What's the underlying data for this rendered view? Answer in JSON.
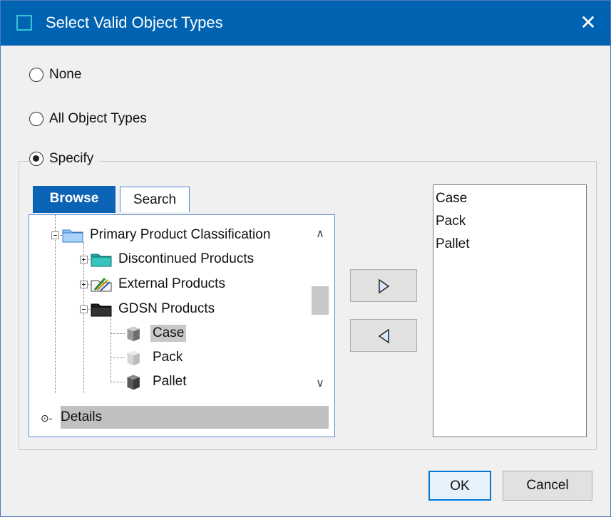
{
  "window": {
    "title": "Select Valid Object Types",
    "close_glyph": "✕"
  },
  "radios": [
    {
      "label": "None",
      "checked": false
    },
    {
      "label": "All Object Types",
      "checked": false
    },
    {
      "label": "Specify",
      "checked": true
    }
  ],
  "tabs": {
    "browse": "Browse",
    "search": "Search",
    "active": "Browse"
  },
  "tree": {
    "nodes": [
      {
        "label": "Primary Product Classification",
        "expanded": true,
        "icon": "folder-blue-icon"
      },
      {
        "label": "Discontinued Products",
        "expanded": false,
        "icon": "folder-teal-icon"
      },
      {
        "label": "External Products",
        "expanded": false,
        "icon": "folder-tools-icon"
      },
      {
        "label": "GDSN Products",
        "expanded": true,
        "icon": "folder-black-icon"
      },
      {
        "label": "Case",
        "selected": true,
        "icon": "box-gray-icon"
      },
      {
        "label": "Pack",
        "selected": false,
        "icon": "box-light-icon"
      },
      {
        "label": "Pallet",
        "selected": false,
        "icon": "box-dark-icon"
      }
    ],
    "scroll_up": "∧",
    "scroll_down": "∨"
  },
  "details": {
    "label": "Details",
    "icon": "⊙-"
  },
  "selected_types": [
    "Case",
    "Pack",
    "Pallet"
  ],
  "buttons": {
    "ok": "OK",
    "cancel": "Cancel"
  },
  "colors": {
    "titlebar": "#0063b1",
    "accent": "#0078d7",
    "tab_active": "#0a63b4",
    "dialog_bg": "#f0f0f0"
  }
}
